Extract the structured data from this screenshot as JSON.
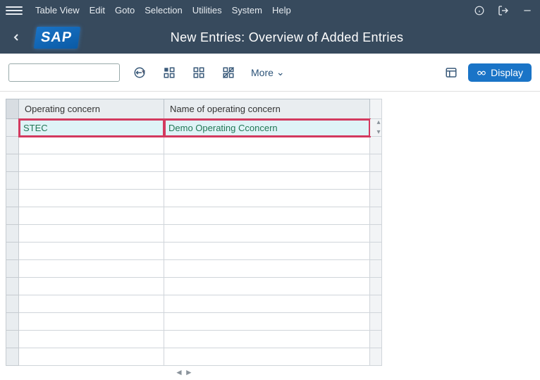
{
  "menubar": {
    "items": [
      {
        "label": "Table View"
      },
      {
        "label": "Edit"
      },
      {
        "label": "Goto"
      },
      {
        "label": "Selection"
      },
      {
        "label": "Utilities"
      },
      {
        "label": "System"
      },
      {
        "label": "Help"
      }
    ]
  },
  "title": "New Entries: Overview of Added Entries",
  "toolbar": {
    "search_value": "",
    "more_label": "More",
    "display_label": "Display"
  },
  "table": {
    "columns": {
      "operating_concern": "Operating concern",
      "name": "Name of operating concern"
    },
    "rows": [
      {
        "operating_concern": "STEC",
        "name": "Demo Operating Cconcern",
        "highlight": true
      },
      {
        "operating_concern": "",
        "name": ""
      },
      {
        "operating_concern": "",
        "name": ""
      },
      {
        "operating_concern": "",
        "name": ""
      },
      {
        "operating_concern": "",
        "name": ""
      },
      {
        "operating_concern": "",
        "name": ""
      },
      {
        "operating_concern": "",
        "name": ""
      },
      {
        "operating_concern": "",
        "name": ""
      },
      {
        "operating_concern": "",
        "name": ""
      },
      {
        "operating_concern": "",
        "name": ""
      },
      {
        "operating_concern": "",
        "name": ""
      },
      {
        "operating_concern": "",
        "name": ""
      },
      {
        "operating_concern": "",
        "name": ""
      },
      {
        "operating_concern": "",
        "name": ""
      }
    ]
  }
}
